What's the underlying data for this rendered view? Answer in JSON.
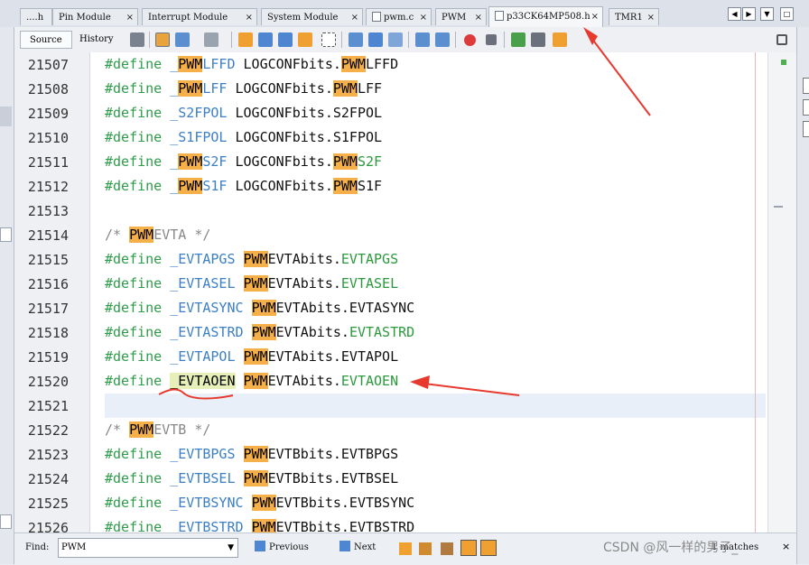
{
  "tabs": [
    {
      "label": "....h"
    },
    {
      "label": "Pin Module"
    },
    {
      "label": "Interrupt Module"
    },
    {
      "label": "System Module"
    },
    {
      "label": "pwm.c"
    },
    {
      "label": "PWM"
    },
    {
      "label": "p33CK64MP508.h"
    },
    {
      "label": "TMR1"
    }
  ],
  "tab_close": "×",
  "view_tabs": {
    "source": "Source",
    "history": "History"
  },
  "lines": [
    {
      "num": "21507",
      "code": [
        [
          "kw",
          "#define "
        ],
        [
          "id",
          "_"
        ],
        [
          "hl",
          "PWM"
        ],
        [
          "id",
          "LFFD "
        ],
        [
          "tx",
          "LOGCONFbits."
        ],
        [
          "hl",
          "PWM"
        ],
        [
          "tx",
          "LFFD"
        ]
      ]
    },
    {
      "num": "21508",
      "code": [
        [
          "kw",
          "#define "
        ],
        [
          "id",
          "_"
        ],
        [
          "hl",
          "PWM"
        ],
        [
          "id",
          "LFF "
        ],
        [
          "tx",
          "LOGCONFbits."
        ],
        [
          "hl",
          "PWM"
        ],
        [
          "tx",
          "LFF"
        ]
      ]
    },
    {
      "num": "21509",
      "code": [
        [
          "kw",
          "#define "
        ],
        [
          "id",
          "_S2FPOL "
        ],
        [
          "tx",
          "LOGCONFbits.S2FPOL"
        ]
      ]
    },
    {
      "num": "21510",
      "code": [
        [
          "kw",
          "#define "
        ],
        [
          "id",
          "_S1FPOL "
        ],
        [
          "tx",
          "LOGCONFbits.S1FPOL"
        ]
      ]
    },
    {
      "num": "21511",
      "code": [
        [
          "kw",
          "#define "
        ],
        [
          "id",
          "_"
        ],
        [
          "hl",
          "PWM"
        ],
        [
          "id",
          "S2F "
        ],
        [
          "tx",
          "LOGCONFbits."
        ],
        [
          "hl",
          "PWM"
        ],
        [
          "fld",
          "S2F"
        ]
      ]
    },
    {
      "num": "21512",
      "code": [
        [
          "kw",
          "#define "
        ],
        [
          "id",
          "_"
        ],
        [
          "hl",
          "PWM"
        ],
        [
          "id",
          "S1F "
        ],
        [
          "tx",
          "LOGCONFbits."
        ],
        [
          "hl",
          "PWM"
        ],
        [
          "tx",
          "S1F"
        ]
      ]
    },
    {
      "num": "21513",
      "code": []
    },
    {
      "num": "21514",
      "code": [
        [
          "cm",
          "/* "
        ],
        [
          "hl",
          "PWM"
        ],
        [
          "cm",
          "EVTA */"
        ]
      ]
    },
    {
      "num": "21515",
      "code": [
        [
          "kw",
          "#define "
        ],
        [
          "id",
          "_EVTAPGS "
        ],
        [
          "hl",
          "PWM"
        ],
        [
          "tx",
          "EVTAbits."
        ],
        [
          "fld",
          "EVTAPGS"
        ]
      ]
    },
    {
      "num": "21516",
      "code": [
        [
          "kw",
          "#define "
        ],
        [
          "id",
          "_EVTASEL "
        ],
        [
          "hl",
          "PWM"
        ],
        [
          "tx",
          "EVTAbits."
        ],
        [
          "fld",
          "EVTASEL"
        ]
      ]
    },
    {
      "num": "21517",
      "code": [
        [
          "kw",
          "#define "
        ],
        [
          "id",
          "_EVTASYNC "
        ],
        [
          "hl",
          "PWM"
        ],
        [
          "tx",
          "EVTAbits.EVTASYNC"
        ]
      ]
    },
    {
      "num": "21518",
      "code": [
        [
          "kw",
          "#define "
        ],
        [
          "id",
          "_EVTASTRD "
        ],
        [
          "hl",
          "PWM"
        ],
        [
          "tx",
          "EVTAbits."
        ],
        [
          "fld",
          "EVTASTRD"
        ]
      ]
    },
    {
      "num": "21519",
      "code": [
        [
          "kw",
          "#define "
        ],
        [
          "id",
          "_EVTAPOL "
        ],
        [
          "hl",
          "PWM"
        ],
        [
          "tx",
          "EVTAbits.EVTAPOL"
        ]
      ]
    },
    {
      "num": "21520",
      "code": [
        [
          "kw",
          "#define "
        ],
        [
          "hlg",
          "_EVTAOEN"
        ],
        [
          "tx",
          " "
        ],
        [
          "hl",
          "PWM"
        ],
        [
          "tx",
          "EVTAbits."
        ],
        [
          "fld",
          "EVTAOEN"
        ]
      ]
    },
    {
      "num": "21521",
      "code": []
    },
    {
      "num": "21522",
      "code": [
        [
          "cm",
          "/* "
        ],
        [
          "hl",
          "PWM"
        ],
        [
          "cm",
          "EVTB */"
        ]
      ]
    },
    {
      "num": "21523",
      "code": [
        [
          "kw",
          "#define "
        ],
        [
          "id",
          "_EVTBPGS "
        ],
        [
          "hl",
          "PWM"
        ],
        [
          "tx",
          "EVTBbits.EVTBPGS"
        ]
      ]
    },
    {
      "num": "21524",
      "code": [
        [
          "kw",
          "#define "
        ],
        [
          "id",
          "_EVTBSEL "
        ],
        [
          "hl",
          "PWM"
        ],
        [
          "tx",
          "EVTBbits.EVTBSEL"
        ]
      ]
    },
    {
      "num": "21525",
      "code": [
        [
          "kw",
          "#define "
        ],
        [
          "id",
          "_EVTBSYNC "
        ],
        [
          "hl",
          "PWM"
        ],
        [
          "tx",
          "EVTBbits.EVTBSYNC"
        ]
      ]
    },
    {
      "num": "21526",
      "code": [
        [
          "kw",
          "#define "
        ],
        [
          "id",
          "_EVTBSTRD "
        ],
        [
          "hl",
          "PWM"
        ],
        [
          "tx",
          "EVTBbits.EVTBSTRD"
        ]
      ]
    }
  ],
  "find": {
    "label": "Find:",
    "value": "PWM",
    "previous": "Previous",
    "next": "Next",
    "matches": "1 matches"
  },
  "watermark": "CSDN @风一样的男子_",
  "colors": {
    "highlight": "#f6b04a",
    "selection_highlight": "#e6f0b8",
    "annotation": "#e8392e"
  }
}
